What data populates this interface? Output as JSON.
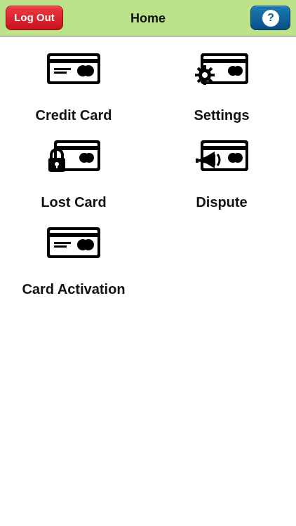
{
  "header": {
    "title": "Home",
    "logout_label": "Log Out",
    "help_label": "?"
  },
  "menu": [
    {
      "label": "Credit Card",
      "icon": "credit-card-icon"
    },
    {
      "label": "Settings",
      "icon": "card-settings-icon"
    },
    {
      "label": "Lost Card",
      "icon": "card-lock-icon"
    },
    {
      "label": "Dispute",
      "icon": "card-megaphone-icon"
    },
    {
      "label": "Card Activation",
      "icon": "credit-card-icon"
    }
  ],
  "colors": {
    "header_bg": "#bde38a",
    "logout_red": "#d61b25",
    "help_blue": "#0d5e98",
    "icon_black": "#000000"
  }
}
